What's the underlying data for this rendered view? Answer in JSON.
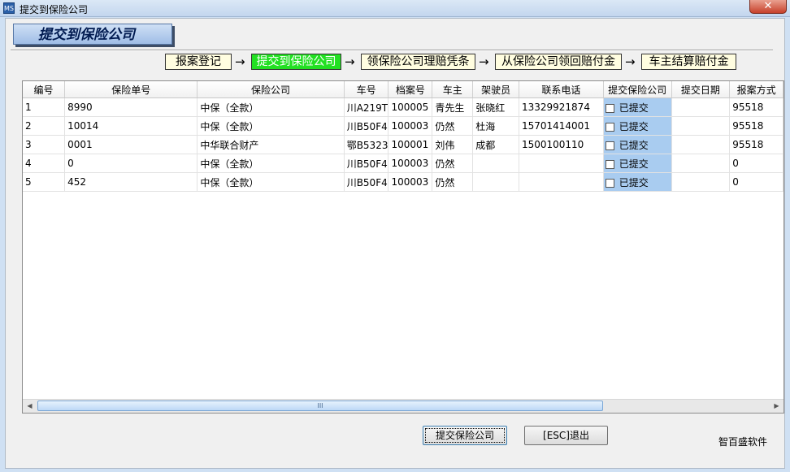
{
  "window": {
    "title": "提交到保险公司",
    "icon_label": "MS",
    "close_icon": "close-icon",
    "close_glyph": "✕"
  },
  "page_title": "提交到保险公司",
  "steps": [
    {
      "label": "报案登记",
      "active": false
    },
    {
      "label": "提交到保险公司",
      "active": true
    },
    {
      "label": "领保险公司理赔凭条",
      "active": false
    },
    {
      "label": "从保险公司领回赔付金",
      "active": false
    },
    {
      "label": "车主结算赔付金",
      "active": false
    }
  ],
  "arrow_glyph": "→",
  "table": {
    "columns": [
      "编号",
      "保险单号",
      "保险公司",
      "车号",
      "档案号",
      "车主",
      "架驶员",
      "联系电话",
      "提交保险公司",
      "提交日期",
      "报案方式"
    ],
    "submitted_label": "已提交",
    "rows": [
      {
        "id": "1",
        "policy": "8990",
        "company": "中保（全款）",
        "plate": "川A219T",
        "file": "100005",
        "owner": "青先生",
        "driver": "张晓红",
        "phone": "13329921874",
        "submitted": false,
        "date": "",
        "report": "95518"
      },
      {
        "id": "2",
        "policy": "10014",
        "company": "中保（全款）",
        "plate": "川B50F4",
        "file": "100003",
        "owner": "仍然",
        "driver": "杜海",
        "phone": "15701414001",
        "submitted": false,
        "date": "",
        "report": "95518"
      },
      {
        "id": "3",
        "policy": "0001",
        "company": "中华联合财产",
        "plate": "鄂B5323",
        "file": "100001",
        "owner": "刘伟",
        "driver": "成都",
        "phone": "1500100110",
        "submitted": false,
        "date": "",
        "report": "95518"
      },
      {
        "id": "4",
        "policy": "0",
        "company": "中保（全款）",
        "plate": "川B50F4",
        "file": "100003",
        "owner": "仍然",
        "driver": "",
        "phone": "",
        "submitted": false,
        "date": "",
        "report": "0"
      },
      {
        "id": "5",
        "policy": "452",
        "company": "中保（全款）",
        "plate": "川B50F4",
        "file": "100003",
        "owner": "仍然",
        "driver": "",
        "phone": "",
        "submitted": false,
        "date": "",
        "report": "0"
      }
    ]
  },
  "scrollbar": {
    "thumb_grip": "III",
    "left_glyph": "◀",
    "right_glyph": "▶"
  },
  "buttons": {
    "submit": "提交保险公司",
    "exit": "[ESC]退出"
  },
  "brand": "智百盛软件"
}
